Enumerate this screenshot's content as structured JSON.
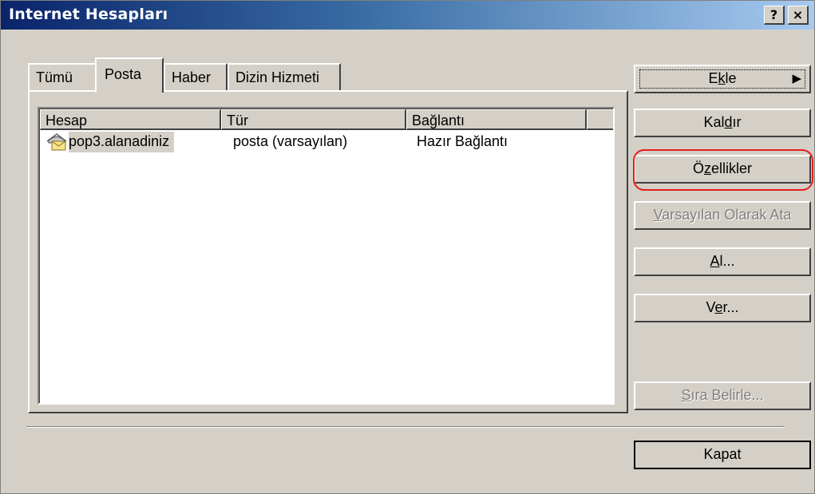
{
  "window": {
    "title": "Internet Hesapları",
    "help_label": "?",
    "close_label": "×"
  },
  "tabs": [
    {
      "label": "Tümü",
      "active": false
    },
    {
      "label": "Posta",
      "active": true
    },
    {
      "label": "Haber",
      "active": false
    },
    {
      "label": "Dizin Hizmeti",
      "active": false
    }
  ],
  "list": {
    "columns": [
      "Hesap",
      "Tür",
      "Bağlantı"
    ],
    "rows": [
      {
        "hesap": "pop3.alanadiniz",
        "tur": "posta (varsayılan)",
        "baglanti": "Hazır Bağlantı",
        "icon": "mail-account-icon",
        "selected": true
      }
    ]
  },
  "buttons": {
    "ekle_pre": "E",
    "ekle_u": "k",
    "ekle_post": "le",
    "ekle_arrow": "▶",
    "kaldir_pre": "Kal",
    "kaldir_u": "d",
    "kaldir_post": "ır",
    "ozellikler_pre": "Ö",
    "ozellikler_u": "z",
    "ozellikler_post": "ellikler",
    "varsayilan_pre": "",
    "varsayilan_u": "V",
    "varsayilan_post": "arsayılan Olarak Ata",
    "al_pre": "",
    "al_u": "A",
    "al_post": "l...",
    "ver_pre": "V",
    "ver_u": "e",
    "ver_post": "r...",
    "sira_pre": "",
    "sira_u": "S",
    "sira_post": "ıra Belirle...",
    "kapat": "Kapat"
  },
  "colors": {
    "highlight": "#e41e1e",
    "titlebar_start": "#0a246a",
    "titlebar_end": "#a6caf0"
  }
}
